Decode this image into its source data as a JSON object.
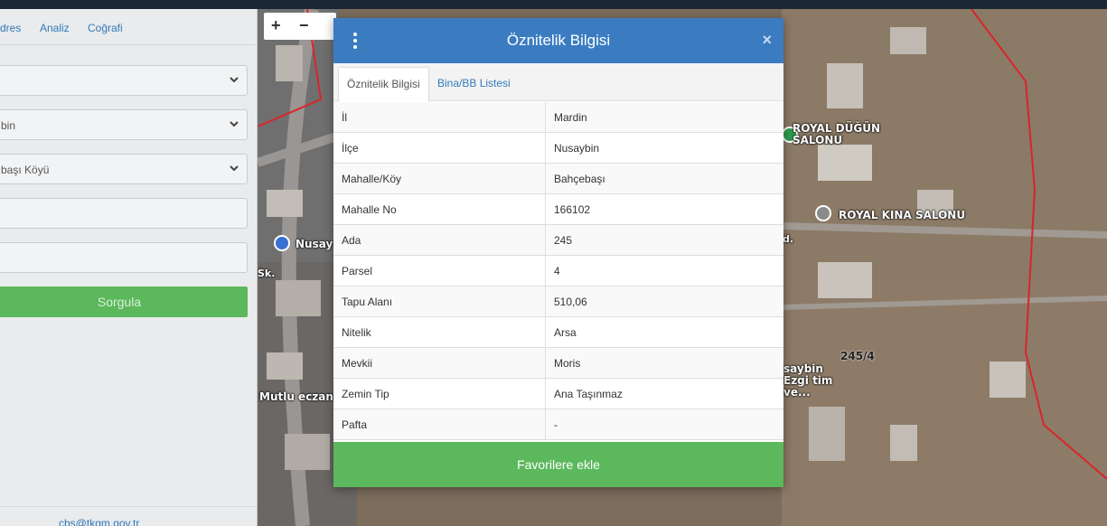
{
  "left_panel": {
    "tabs": [
      "dres",
      "Analiz",
      "Coğrafi"
    ],
    "selects": [
      {
        "value": ""
      },
      {
        "value": "bin"
      },
      {
        "value": "başı Köyü"
      }
    ],
    "query_button": "Sorgula",
    "footer_email": "cbs@tkgm.gov.tr"
  },
  "map": {
    "zoom_in": "+",
    "zoom_out": "−",
    "labels": {
      "wedding_hall": "ROYAL DÜĞÜN SALONU",
      "kina_hall": "ROYAL KINA SALONU",
      "nusay": "Nusay",
      "parcel": "245/4",
      "ezgi": "saybin Ezgi tim ve...",
      "eczane": "Mutlu eczan",
      "sk": "Sk.",
      "d": "d."
    },
    "colors": {
      "boundary": "#d9252b",
      "green_pin": "#2e9b4e",
      "blue_pin": "#3b6fd0"
    }
  },
  "modal": {
    "title": "Öznitelik Bilgisi",
    "close_label": "×",
    "tabs": [
      {
        "label": "Öznitelik Bilgisi",
        "active": true
      },
      {
        "label": "Bina/BB Listesi",
        "active": false
      }
    ],
    "rows": [
      {
        "key": "İl",
        "value": "Mardin"
      },
      {
        "key": "İlçe",
        "value": "Nusaybin"
      },
      {
        "key": "Mahalle/Köy",
        "value": "Bahçebaşı"
      },
      {
        "key": "Mahalle No",
        "value": "166102"
      },
      {
        "key": "Ada",
        "value": "245"
      },
      {
        "key": "Parsel",
        "value": "4"
      },
      {
        "key": "Tapu Alanı",
        "value": "510,06"
      },
      {
        "key": "Nitelik",
        "value": "Arsa"
      },
      {
        "key": "Mevkii",
        "value": "Moris"
      },
      {
        "key": "Zemin Tip",
        "value": "Ana Taşınmaz"
      },
      {
        "key": "Pafta",
        "value": "-"
      }
    ],
    "favorite_button": "Favorilere ekle",
    "colors": {
      "header": "#3b7cc1",
      "button": "#5cb85c"
    }
  }
}
